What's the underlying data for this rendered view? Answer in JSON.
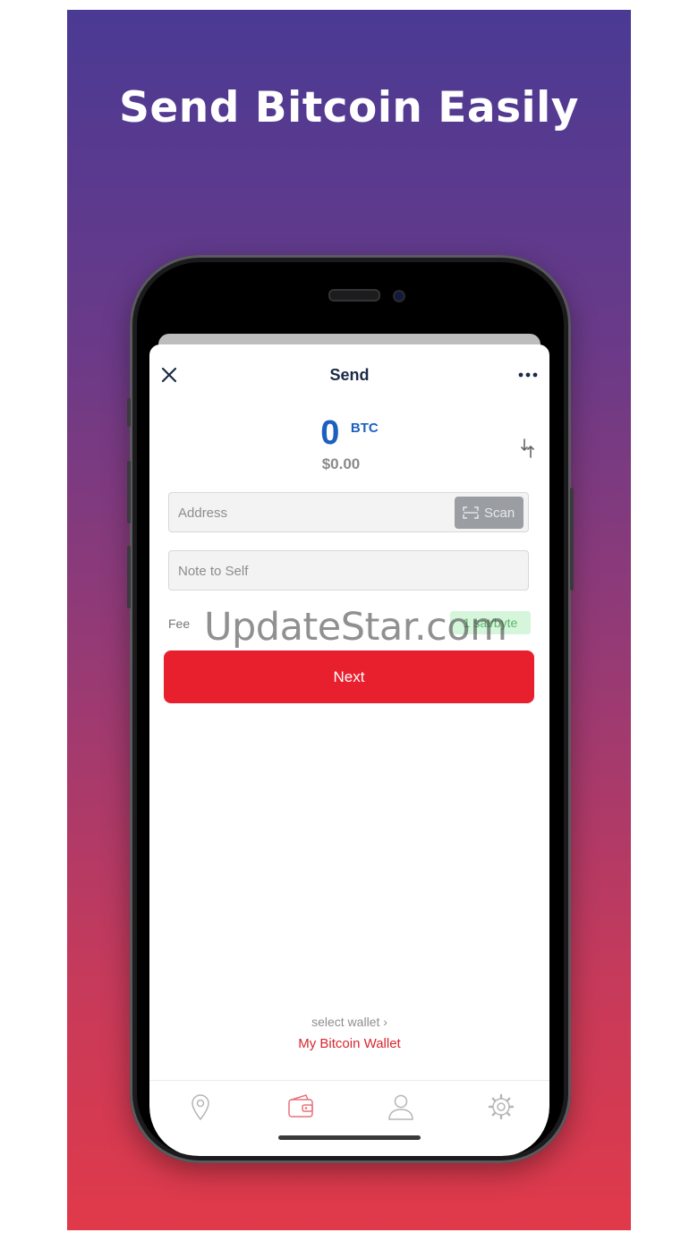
{
  "headline": "Send Bitcoin Easily",
  "send_screen": {
    "title": "Send",
    "close_icon": "close-icon",
    "more_icon": "more-horizontal-icon",
    "amount": {
      "value": "0",
      "unit": "BTC",
      "fiat": "$0.00",
      "accent_color": "#1d5fbf"
    },
    "address_field": {
      "placeholder": "Address",
      "scan_label": "Scan"
    },
    "note_field": {
      "placeholder": "Note to Self"
    },
    "fee": {
      "label": "Fee",
      "value": "1 sat/byte"
    },
    "next_button": {
      "label": "Next",
      "color": "#e8202e"
    },
    "wallet_selector": {
      "hint": "select wallet  ›",
      "name": "My Bitcoin Wallet"
    }
  },
  "tabbar": {
    "tabs": [
      {
        "icon": "location-pin-icon",
        "active": false
      },
      {
        "icon": "wallet-icon",
        "active": true
      },
      {
        "icon": "user-icon",
        "active": false
      },
      {
        "icon": "settings-gear-icon",
        "active": false
      }
    ]
  },
  "watermark": "UpdateStar.com"
}
